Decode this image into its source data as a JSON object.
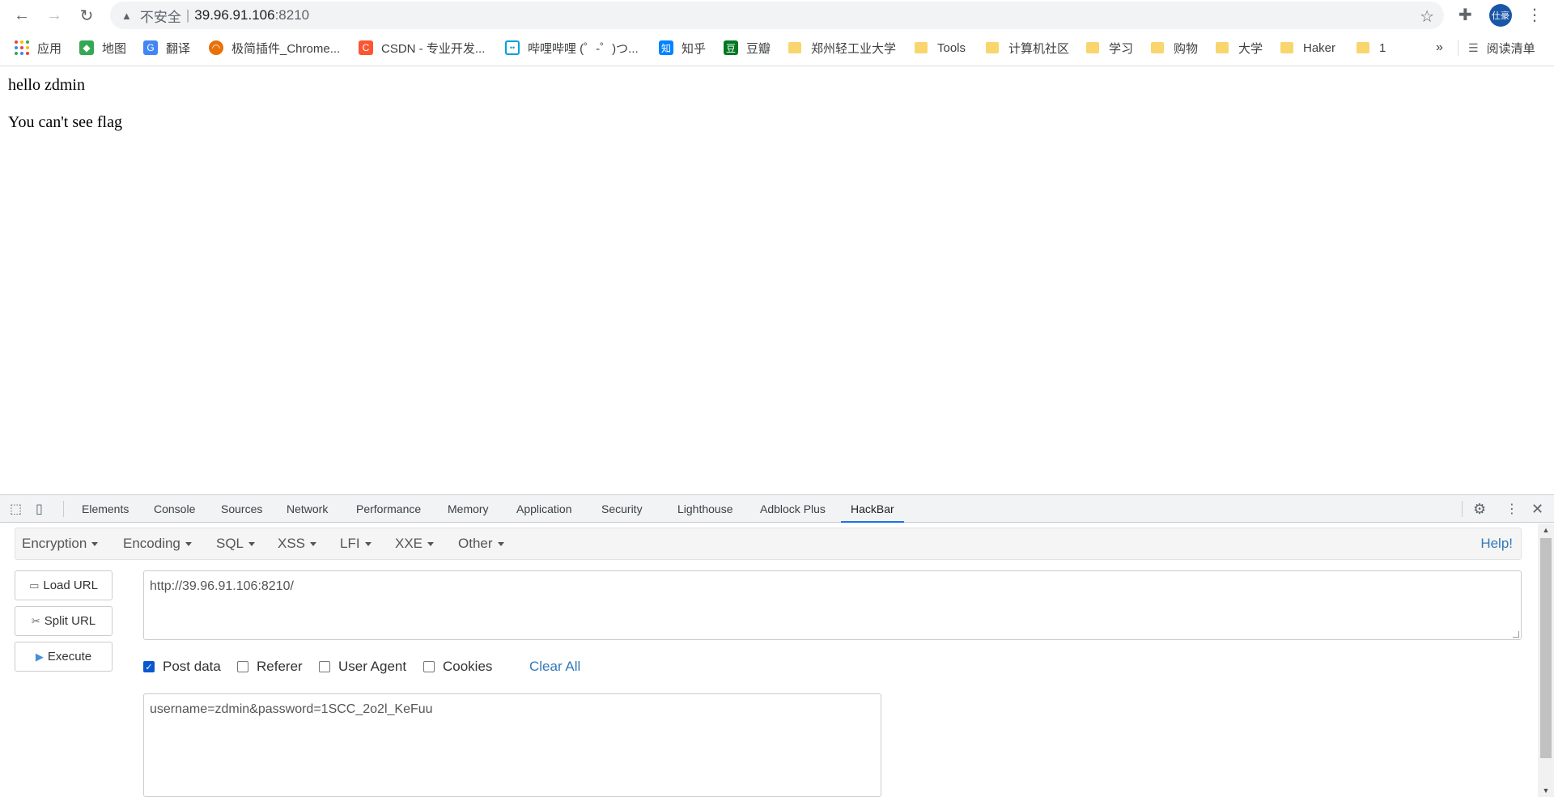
{
  "browser": {
    "address": {
      "insecure_label": "不安全",
      "separator": "|",
      "host": "39.96.91.106",
      "port": ":8210"
    },
    "avatar_label": "仕豪"
  },
  "bookmarks": {
    "items": [
      {
        "label": "应用",
        "icon": "apps-icon"
      },
      {
        "label": "地图",
        "icon": "maps-icon"
      },
      {
        "label": "翻译",
        "icon": "translate-icon"
      },
      {
        "label": "极简插件_Chrome...",
        "icon": "extension-site-icon"
      },
      {
        "label": "CSDN - 专业开发...",
        "icon": "csdn-icon",
        "glyph": "C"
      },
      {
        "label": "哔哩哔哩 (゜-゜)つ...",
        "icon": "bilibili-icon"
      },
      {
        "label": "知乎",
        "icon": "zhihu-icon",
        "glyph": "知"
      },
      {
        "label": "豆瓣",
        "icon": "douban-icon",
        "glyph": "豆"
      },
      {
        "label": "郑州轻工业大学",
        "icon": "folder-icon"
      },
      {
        "label": "Tools",
        "icon": "folder-icon"
      },
      {
        "label": "计算机社区",
        "icon": "folder-icon"
      },
      {
        "label": "学习",
        "icon": "folder-icon"
      },
      {
        "label": "购物",
        "icon": "folder-icon"
      },
      {
        "label": "大学",
        "icon": "folder-icon"
      },
      {
        "label": "Haker",
        "icon": "folder-icon"
      },
      {
        "label": "1",
        "icon": "folder-icon"
      }
    ],
    "overflow": "»",
    "reading_list": "阅读清单"
  },
  "page": {
    "line1": "hello zdmin",
    "line2": "You can't see flag"
  },
  "devtools": {
    "tabs": [
      "Elements",
      "Console",
      "Sources",
      "Network",
      "Performance",
      "Memory",
      "Application",
      "Security",
      "Lighthouse",
      "Adblock Plus",
      "HackBar"
    ],
    "active_tab": "HackBar"
  },
  "hackbar": {
    "menus": [
      "Encryption",
      "Encoding",
      "SQL",
      "XSS",
      "LFI",
      "XXE",
      "Other"
    ],
    "help": "Help!",
    "buttons": {
      "load_url": "Load URL",
      "split_url": "Split URL",
      "execute": "Execute"
    },
    "url_value": "http://39.96.91.106:8210/",
    "options": {
      "post_data": {
        "label": "Post data",
        "checked": true
      },
      "referer": {
        "label": "Referer",
        "checked": false
      },
      "user_agent": {
        "label": "User Agent",
        "checked": false
      },
      "cookies": {
        "label": "Cookies",
        "checked": false
      }
    },
    "clear_all": "Clear All",
    "post_value": "username=zdmin&password=1SCC_2o2l_KeFuu"
  }
}
